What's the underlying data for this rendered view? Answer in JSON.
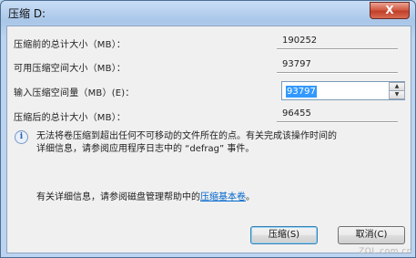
{
  "window": {
    "title": "压缩 D:",
    "close_label": "X"
  },
  "fields": {
    "total_before": {
      "label": "压缩前的总计大小（MB）：",
      "value": "190252"
    },
    "available": {
      "label": "可用压缩空间大小（MB）：",
      "value": "93797"
    },
    "input": {
      "label": "输入压缩空间量（MB）(E)：",
      "value": "93797"
    },
    "total_after": {
      "label": "压缩后的总计大小（MB）：",
      "value": "96455"
    }
  },
  "info": {
    "icon": "info-icon",
    "line1": "无法将卷压缩到超出任何不可移动的文件所在的点。有关完成该操作时间的",
    "line2": "详细信息，请参阅应用程序日志中的 “defrag” 事件。"
  },
  "help": {
    "prefix": "有关详细信息，请参阅磁盘管理帮助中的",
    "link": "压缩基本卷",
    "suffix": "。"
  },
  "buttons": {
    "shrink": "压缩(S)",
    "cancel": "取消(C)"
  },
  "watermark": "ZOL.com.cn"
}
